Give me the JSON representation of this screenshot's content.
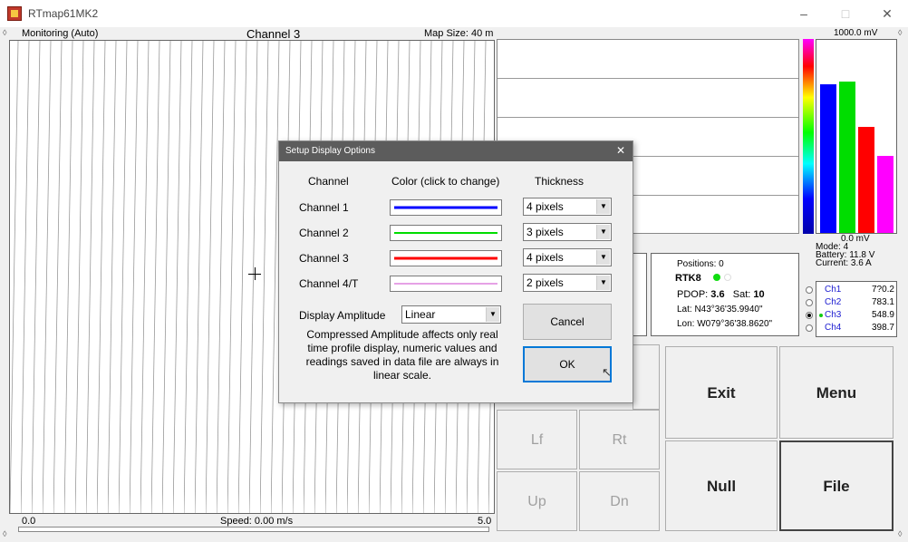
{
  "window": {
    "title": "RTmap61MK2",
    "minimize": "–",
    "maximize": "□",
    "close": "✕"
  },
  "map": {
    "mode_label": "Monitoring (Auto)",
    "channel_label": "Channel 3",
    "map_size_label": "Map Size:  40 m",
    "x_start": "0.0",
    "speed_label": "Speed:  0.00 m/s",
    "x_end": "5.0"
  },
  "bars": {
    "scale_top": "1000.0 mV",
    "scale_bottom": "0.0 mV",
    "values_mV": [
      770.2,
      783.1,
      548.9,
      398.7
    ],
    "colors": [
      "#0000ff",
      "#00dd00",
      "#ff0000",
      "#ff00ff"
    ]
  },
  "status": {
    "mode": "Mode:   4",
    "battery": "Battery:  11.8 V",
    "current": "Current:  3.6 A",
    "positions": "Positions:  0",
    "rtk": "RTK8",
    "pdop_label": "PDOP:",
    "pdop_value": "3.6",
    "sat_label": "Sat:",
    "sat_value": "10",
    "lat": "Lat:  N43°36'35.9940\"",
    "lon": "Lon:  W079°36'38.8620\""
  },
  "channels": [
    {
      "name": "Ch1",
      "value": "7?0.2"
    },
    {
      "name": "Ch2",
      "value": "783.1"
    },
    {
      "name": "Ch3",
      "value": "548.9"
    },
    {
      "name": "Ch4",
      "value": "398.7"
    }
  ],
  "buttons": {
    "exit": "Exit",
    "menu": "Menu",
    "lf": "Lf",
    "rt": "Rt",
    "null": "Null",
    "file": "File",
    "up": "Up",
    "dn": "Dn"
  },
  "dialog": {
    "title": "Setup Display Options",
    "close": "✕",
    "col_channel": "Channel",
    "col_color": "Color (click to change)",
    "col_thickness": "Thickness",
    "rows": [
      {
        "name": "Channel 1",
        "color": "#0000ff",
        "thickness": "4 pixels"
      },
      {
        "name": "Channel 2",
        "color": "#00dd00",
        "thickness": "3 pixels"
      },
      {
        "name": "Channel 3",
        "color": "#ff0000",
        "thickness": "4 pixels"
      },
      {
        "name": "Channel 4/T",
        "color": "#cc44cc",
        "thickness": "2 pixels"
      }
    ],
    "amplitude_label": "Display Amplitude",
    "amplitude_value": "Linear",
    "note": "Compressed Amplitude affects only real time profile display, numeric values and readings saved in data file are always in linear scale.",
    "cancel": "Cancel",
    "ok": "OK"
  }
}
